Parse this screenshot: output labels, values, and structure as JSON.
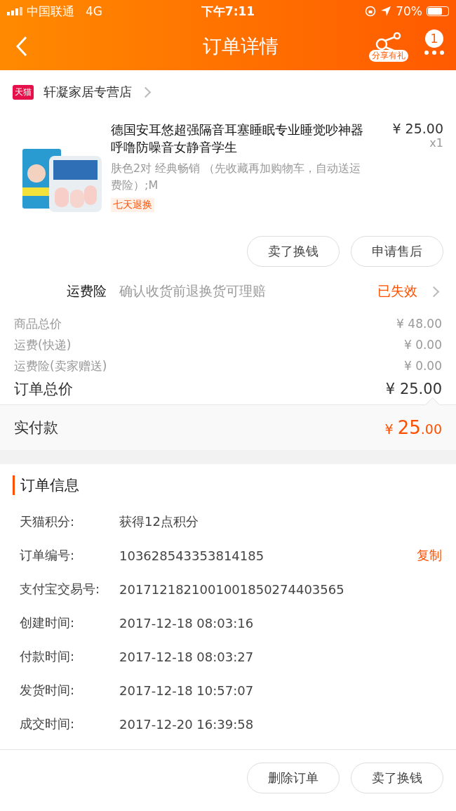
{
  "status_bar": {
    "carrier": "中国联通",
    "network": "4G",
    "time": "下午7:11",
    "battery": "70%"
  },
  "nav": {
    "title": "订单详情",
    "share_label": "分享有礼",
    "badge": "1"
  },
  "shop": {
    "badge": "天猫",
    "name": "轩凝家居专营店"
  },
  "product": {
    "title": "德国安耳悠超强隔音耳塞睡眠专业睡觉吵神器呼噜防噪音女静音学生",
    "sku": "肤色2对 经典畅销 （先收藏再加购物车，自动送运费险）;M",
    "tag": "七天退换",
    "price": "¥ 25.00",
    "quantity": "x1"
  },
  "item_buttons": [
    "卖了换钱",
    "申请售后"
  ],
  "insurance": {
    "label": "运费险",
    "description": "确认收货前退换货可理赔",
    "status": "已失效"
  },
  "costs": [
    {
      "label": "商品总价",
      "value": "¥ 48.00"
    },
    {
      "label": "运费(快递)",
      "value": "¥ 0.00"
    },
    {
      "label": "运费险(卖家赠送)",
      "value": "¥ 0.00"
    }
  ],
  "order_total": {
    "label": "订单总价",
    "value": "¥ 25.00"
  },
  "paid": {
    "label": "实付款",
    "currency": "¥ ",
    "integer": "25",
    "decimal": ".00"
  },
  "order_info": {
    "title": "订单信息",
    "rows": [
      {
        "label": "天猫积分:",
        "value": "获得12点积分"
      },
      {
        "label": "订单编号:",
        "value": "103628543353814185",
        "action": "复制"
      },
      {
        "label": "支付宝交易号:",
        "value": "2017121821001001850274403565"
      },
      {
        "label": "创建时间:",
        "value": "2017-12-18 08:03:16"
      },
      {
        "label": "付款时间:",
        "value": "2017-12-18 08:03:27"
      },
      {
        "label": "发货时间:",
        "value": "2017-12-18 10:57:07"
      },
      {
        "label": "成交时间:",
        "value": "2017-12-20 16:39:58"
      }
    ]
  },
  "footer_buttons": [
    "删除订单",
    "卖了换钱"
  ]
}
